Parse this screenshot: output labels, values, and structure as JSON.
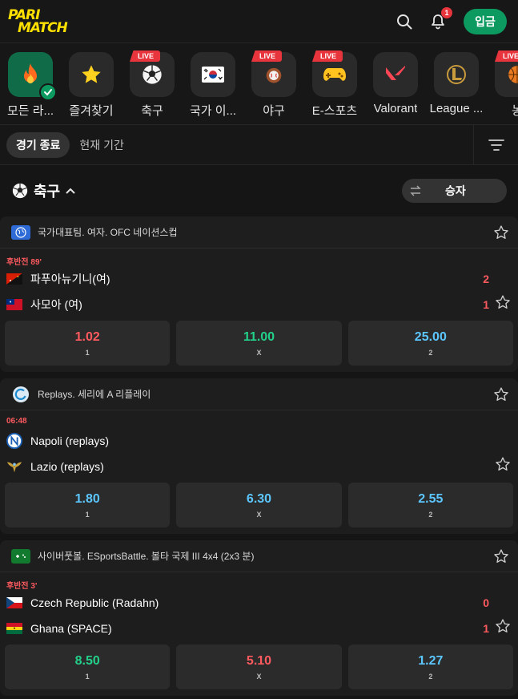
{
  "header": {
    "logo_line1": "PARI",
    "logo_line2": "MATCH",
    "notification_count": "1",
    "deposit_label": "입금"
  },
  "categories": [
    {
      "label": "모든 라...",
      "icon": "fire-icon",
      "live": false,
      "active": true
    },
    {
      "label": "즐겨찾기",
      "icon": "star-icon",
      "live": false
    },
    {
      "label": "축구",
      "icon": "soccer-ball-icon",
      "live": true
    },
    {
      "label": "국가 이...",
      "icon": "korea-flag-icon",
      "live": false
    },
    {
      "label": "야구",
      "icon": "baseball-icon",
      "live": true
    },
    {
      "label": "E-스포츠",
      "icon": "gamepad-icon",
      "live": true
    },
    {
      "label": "Valorant",
      "icon": "valorant-icon",
      "live": false
    },
    {
      "label": "League ...",
      "icon": "league-of-legends-icon",
      "live": false
    },
    {
      "label": "농",
      "icon": "basketball-icon",
      "live": true
    }
  ],
  "live_label": "LIVE",
  "filters": {
    "ended": "경기 종료",
    "period": "현재 기간"
  },
  "sport": {
    "title": "축구",
    "market": "승자"
  },
  "leagues": [
    {
      "name": "국가대표팀. 여자. OFC 네이션스컵",
      "icon": "globe-icon",
      "time": "후반전 89'",
      "team1": "파푸아뉴기니(여)",
      "team2": "사모아 (여)",
      "score1": "2",
      "score2": "1",
      "odds": [
        {
          "value": "1.02",
          "label": "1",
          "color": "#ff5a5f"
        },
        {
          "value": "11.00",
          "label": "X",
          "color": "#22d08a"
        },
        {
          "value": "25.00",
          "label": "2",
          "color": "#5cc6ff"
        }
      ]
    },
    {
      "name": "Replays. 세리에 A 리플레이",
      "icon": "replay-icon",
      "time": "06:48",
      "team1": "Napoli (replays)",
      "team2": "Lazio (replays)",
      "score1": "",
      "score2": "",
      "odds": [
        {
          "value": "1.80",
          "label": "1",
          "color": "#5cc6ff"
        },
        {
          "value": "6.30",
          "label": "X",
          "color": "#5cc6ff"
        },
        {
          "value": "2.55",
          "label": "2",
          "color": "#5cc6ff"
        }
      ]
    },
    {
      "name": "사이버풋볼. ESportsBattle. 볼타 국제 III 4x4 (2x3 분)",
      "icon": "cyber-football-icon",
      "time": "후반전 3'",
      "team1": "Czech Republic (Radahn)",
      "team2": "Ghana (SPACE)",
      "score1": "0",
      "score2": "1",
      "odds": [
        {
          "value": "8.50",
          "label": "1",
          "color": "#22d08a"
        },
        {
          "value": "5.10",
          "label": "X",
          "color": "#ff5a5f"
        },
        {
          "value": "1.27",
          "label": "2",
          "color": "#5cc6ff"
        }
      ]
    }
  ]
}
